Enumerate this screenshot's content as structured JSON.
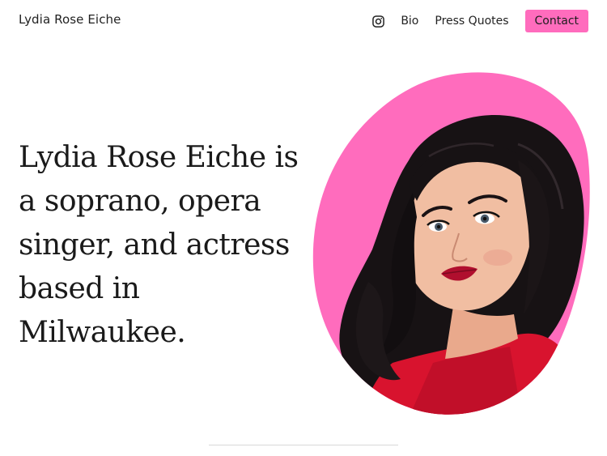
{
  "header": {
    "site_title": "Lydia Rose Eiche",
    "nav": {
      "instagram_icon": "instagram-icon",
      "bio_label": "Bio",
      "press_quotes_label": "Press Quotes",
      "contact_label": "Contact"
    }
  },
  "hero": {
    "headline": "Lydia Rose Eiche is a soprano, opera singer, and actress based in Milwaukee.",
    "portrait_icon": "portrait-photo"
  },
  "colors": {
    "accent_pink": "#ff6cbd",
    "text": "#1a1a1a",
    "background": "#ffffff",
    "divider": "#d8d8d8"
  }
}
